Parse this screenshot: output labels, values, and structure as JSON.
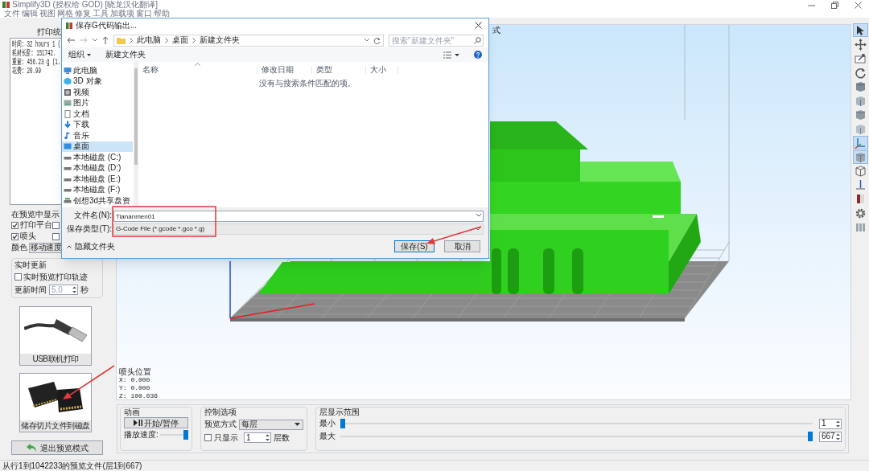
{
  "title_bar": {
    "title": "Simplify3D (授权给 GOD) [晓龙汉化翻译]"
  },
  "menu": [
    "文件",
    "编辑",
    "视图",
    "网格",
    "修复",
    "工具",
    "加载项",
    "窗口",
    "帮助"
  ],
  "stats_panel": {
    "header": "打印统",
    "lines": [
      "时间: 32 hours 1 (",
      "耗材长度: 151742.",
      "重量: 456.23 g (1.",
      "花费: 20.99"
    ]
  },
  "display_options": {
    "title": "在预览中显示",
    "checkboxes": [
      {
        "label": "打印平台",
        "checked": true
      },
      {
        "checked": false
      },
      {
        "label": "喷头",
        "checked": true
      },
      {
        "checked": false
      }
    ],
    "color_label": "颜色",
    "color_value": "移动速度"
  },
  "live_update": {
    "title": "实时更新",
    "checkbox": {
      "label": "实时预览打印轨迹",
      "checked": false
    },
    "interval_label": "更新时间",
    "interval_value": "5.0",
    "interval_unit": "秒"
  },
  "output_buttons": [
    {
      "kind": "usb",
      "label": "USB联机打印"
    },
    {
      "kind": "sd",
      "label": "储存切片文件到磁盘"
    }
  ],
  "exit_button": "退出预览模式",
  "view": {
    "title": "式",
    "nozzle": {
      "title": "喷头位置",
      "lines": [
        "X: 0.000",
        "Y: 0.000",
        "Z: 100.036"
      ]
    }
  },
  "animation": {
    "title": "动画",
    "play_button": "开始/暂停",
    "speed_label": "播放速度:",
    "speed": {
      "level": 1
    }
  },
  "controls": {
    "title": "控制选项",
    "mode_label": "预览方式",
    "mode_value": "每层",
    "only_show": {
      "label": "只显示",
      "checked": false
    },
    "count_value": "1",
    "count_unit": "层数"
  },
  "layer_range": {
    "title": "层显示范围",
    "rows": [
      {
        "label": "最小",
        "level": 0,
        "value": "1"
      },
      {
        "label": "最大",
        "level": 1,
        "value": "667"
      }
    ]
  },
  "toolbar": [
    {
      "selected": true
    },
    {
      "selected": false
    },
    {
      "selected": false
    },
    {
      "selected": false
    },
    {
      "selected": false
    },
    {
      "selected": false
    },
    {
      "selected": false
    },
    {
      "selected": false
    },
    {
      "selected": true
    },
    {
      "selected": true
    },
    {
      "selected": false
    },
    {
      "selected": false
    },
    {
      "selected": false
    },
    {
      "selected": false
    },
    {
      "selected": false
    }
  ],
  "status_bar": "从行1到1042233的预览文件(层1到667)",
  "dialog": {
    "title": "保存G代码输出...",
    "path": [
      "此电脑",
      "桌面",
      "新建文件夹"
    ],
    "search_placeholder": "搜索\"新建文件夹\"",
    "organize": "组织",
    "new_folder": "新建文件夹",
    "nav": [
      {
        "kind": "pc",
        "label": "此电脑",
        "selected": false
      },
      {
        "kind": "obj3d",
        "label": "3D 对象",
        "selected": false
      },
      {
        "kind": "video",
        "label": "视频",
        "selected": false
      },
      {
        "kind": "pictures",
        "label": "图片",
        "selected": false
      },
      {
        "kind": "documents",
        "label": "文档",
        "selected": false
      },
      {
        "kind": "downloads",
        "label": "下载",
        "selected": false
      },
      {
        "kind": "music",
        "label": "音乐",
        "selected": false
      },
      {
        "kind": "desktop",
        "label": "桌面",
        "selected": true
      },
      {
        "kind": "drive",
        "label": "本地磁盘 (C:)",
        "selected": false
      },
      {
        "kind": "drive",
        "label": "本地磁盘 (D:)",
        "selected": false
      },
      {
        "kind": "drive",
        "label": "本地磁盘 (E:)",
        "selected": false
      },
      {
        "kind": "drive",
        "label": "本地磁盘 (F:)",
        "selected": false
      },
      {
        "kind": "network",
        "label": "创想3d共享盘资",
        "selected": false
      }
    ],
    "columns": [
      "名称",
      "修改日期",
      "类型",
      "大小"
    ],
    "empty_message": "没有与搜索条件匹配的项。",
    "file_name_label": "文件名(N):",
    "file_name": "Tiananmen01",
    "file_type_label": "保存类型(T):",
    "file_type": "G-Code File (*.gcode *.gco *.g)",
    "hide_folders": "隐藏文件夹",
    "buttons": [
      {
        "label": "保存(S)",
        "default": true
      },
      {
        "label": "取消",
        "default": false
      }
    ]
  }
}
